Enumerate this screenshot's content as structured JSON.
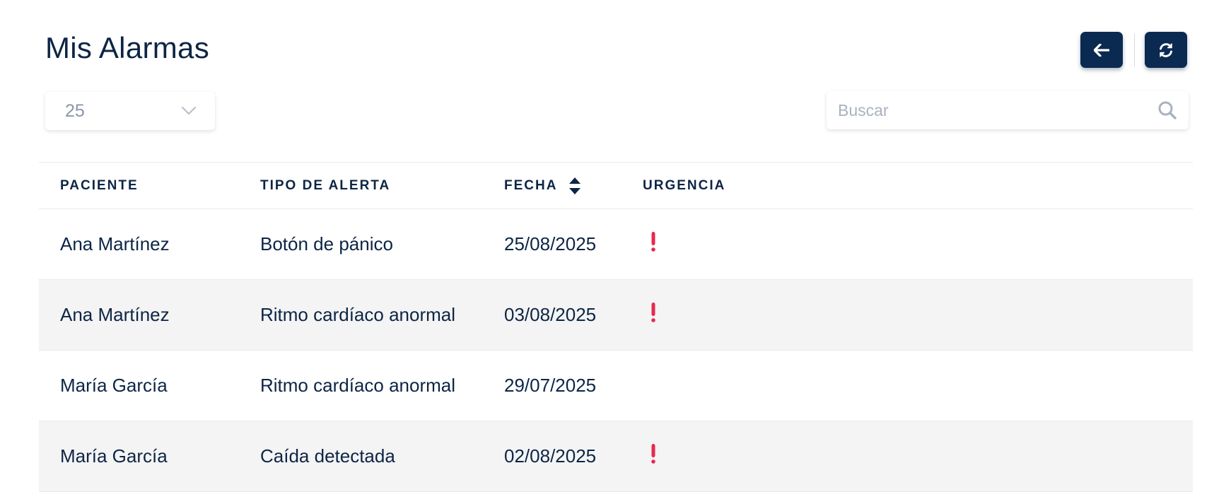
{
  "header": {
    "title": "Mis Alarmas"
  },
  "toolbar": {
    "back_icon": "arrow-left-icon",
    "refresh_icon": "refresh-icon",
    "button_color": "#0b2a52"
  },
  "controls": {
    "page_size": "25",
    "page_size_icon": "chevron-down-icon",
    "search_placeholder": "Buscar",
    "search_value": "",
    "search_icon": "search-icon"
  },
  "table": {
    "columns": [
      "PACIENTE",
      "TIPO DE ALERTA",
      "FECHA",
      "URGENCIA"
    ],
    "sorted_column": "FECHA",
    "sort_icon": "sort-icon",
    "urgency_icon": "exclamation-icon",
    "urgency_color": "#e8284f",
    "rows": [
      {
        "paciente": "Ana Martínez",
        "tipo": "Botón de pánico",
        "fecha": "25/08/2025",
        "urgent": true
      },
      {
        "paciente": "Ana Martínez",
        "tipo": "Ritmo cardíaco anormal",
        "fecha": "03/08/2025",
        "urgent": true
      },
      {
        "paciente": "María García",
        "tipo": "Ritmo cardíaco anormal",
        "fecha": "29/07/2025",
        "urgent": false
      },
      {
        "paciente": "María García",
        "tipo": "Caída detectada",
        "fecha": "02/08/2025",
        "urgent": true
      }
    ]
  }
}
